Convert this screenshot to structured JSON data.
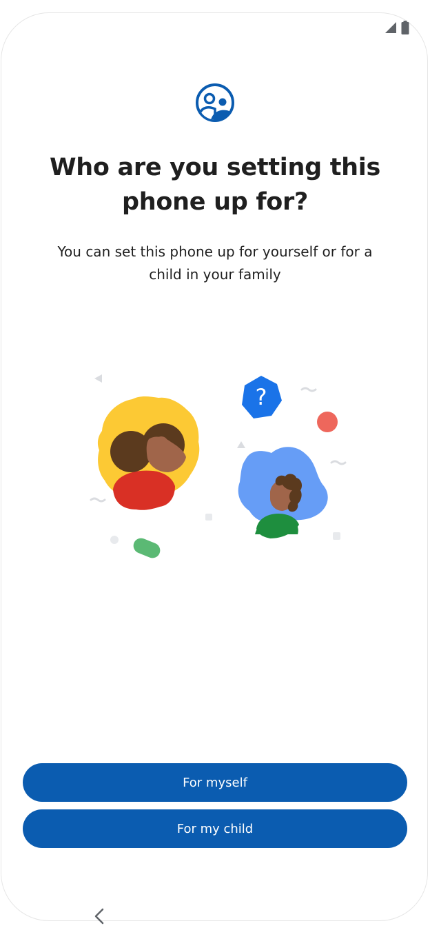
{
  "status_bar": {
    "icons": [
      "cell-signal-icon",
      "battery-icon"
    ]
  },
  "header": {
    "icon": "family-icon",
    "title": "Who are you setting this phone up for?",
    "subtitle": "You can set this phone up for yourself or for a child in your family"
  },
  "illustration": {
    "icon": "parent-and-child-illustration",
    "question_mark": "?"
  },
  "actions": {
    "myself_label": "For myself",
    "child_label": "For my child"
  },
  "nav": {
    "back_icon": "back-chevron-icon"
  },
  "colors": {
    "primary": "#0b5cb0",
    "accent_blue": "#1a73e8",
    "yellow": "#fcc934",
    "red": "#d93025",
    "green": "#1e8e3e",
    "light_blue": "#669df6"
  }
}
